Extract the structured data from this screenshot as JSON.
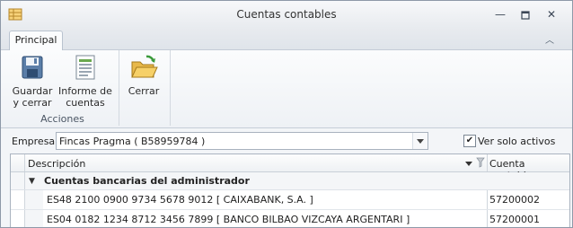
{
  "window": {
    "title": "Cuentas contables"
  },
  "tabs": [
    {
      "label": "Principal"
    }
  ],
  "ribbon": {
    "groups": [
      {
        "label": "Acciones",
        "buttons": [
          {
            "label": "Guardar\ny cerrar",
            "icon": "save-icon"
          },
          {
            "label": "Informe de\ncuentas",
            "icon": "report-icon"
          }
        ]
      },
      {
        "label": "",
        "buttons": [
          {
            "label": "Cerrar",
            "icon": "open-folder-icon"
          }
        ]
      }
    ]
  },
  "empresa": {
    "label": "Empresa:",
    "value": "Fincas Pragma ( B58959784 )"
  },
  "filter": {
    "label": "Ver solo activos",
    "checked": true
  },
  "grid": {
    "columns": [
      {
        "label": "Descripción"
      },
      {
        "label": "Cuenta contable"
      }
    ],
    "group": {
      "label": "Cuentas bancarias del administrador",
      "expander": "▼"
    },
    "rows": [
      {
        "descripcion": "ES48 2100 0900 9734 5678 9012 [ CAIXABANK, S.A. ]",
        "cuenta": "57200002"
      },
      {
        "descripcion": "ES04 0182 1234 8712 3456 7899 [ BANCO BILBAO VIZCAYA ARGENTARI ]",
        "cuenta": "57200001"
      }
    ]
  }
}
